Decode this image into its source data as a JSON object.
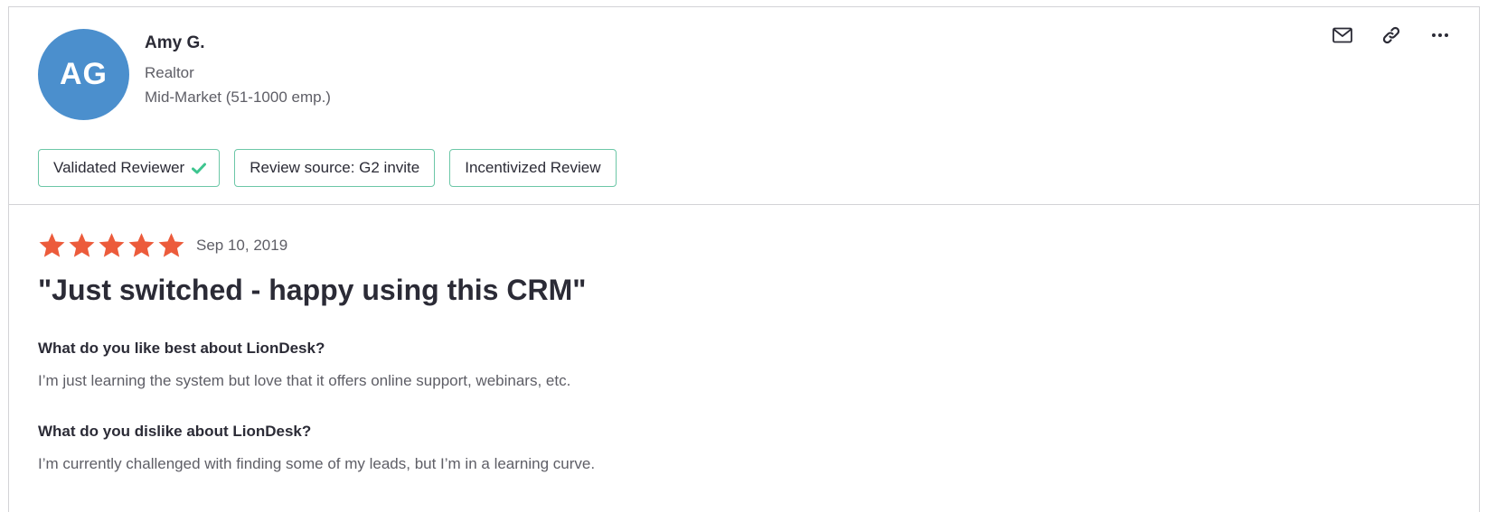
{
  "reviewer": {
    "initials": "AG",
    "name": "Amy G.",
    "title": "Realtor",
    "company_size": "Mid-Market (51-1000 emp.)",
    "avatar_color": "#4b8fcd"
  },
  "actions": [
    {
      "icon": "envelope-icon"
    },
    {
      "icon": "link-icon"
    },
    {
      "icon": "more-options-icon"
    }
  ],
  "badges": {
    "validated": "Validated Reviewer",
    "source": "Review source: G2 invite",
    "incentivized": "Incentivized Review",
    "border_color": "#6cc7a7",
    "check_color": "#3ec58f"
  },
  "review": {
    "rating": 5,
    "max_rating": 5,
    "star_color": "#ec5b3b",
    "date": "Sep 10, 2019",
    "title": "\"Just switched - happy using this CRM\"",
    "questions": [
      {
        "question": "What do you like best about LionDesk?",
        "answer": "I’m just learning the system but love that it offers online support, webinars, etc."
      },
      {
        "question": "What do you dislike about LionDesk?",
        "answer": "I’m currently challenged with finding some of my leads, but I’m in a learning curve."
      }
    ]
  }
}
